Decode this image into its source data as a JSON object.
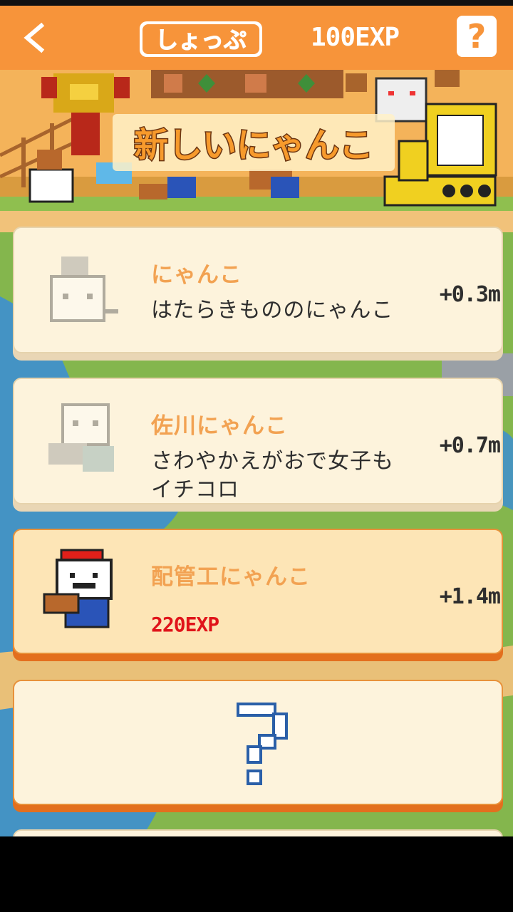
{
  "header": {
    "back_icon": "chevron-left-icon",
    "title": "しょっぷ",
    "exp": "100EXP",
    "help_label": "?",
    "colors": {
      "bar": "#f7943a",
      "text": "#ffffff"
    }
  },
  "banner": {
    "title": "新しいにゃんこ"
  },
  "items": [
    {
      "title": "にゃんこ",
      "desc": "はたらきもののにゃんこ",
      "rate": "+0.3m",
      "state": "owned"
    },
    {
      "title": "佐川にゃんこ",
      "desc": "さわやかえがおで女子もイチコロ",
      "rate": "+0.7m",
      "state": "owned"
    },
    {
      "title": "配管工にゃんこ",
      "price": "220EXP",
      "rate": "+1.4m",
      "state": "purchasable"
    },
    {
      "title": "",
      "state": "locked",
      "icon": "question-mark-icon"
    }
  ],
  "colors": {
    "title_orange": "#f2a252",
    "price_red": "#e0141a",
    "card_bg": "#fdf3dc",
    "highlight_bg": "#fde5b6",
    "unknown_q": "#2a5fa8"
  }
}
